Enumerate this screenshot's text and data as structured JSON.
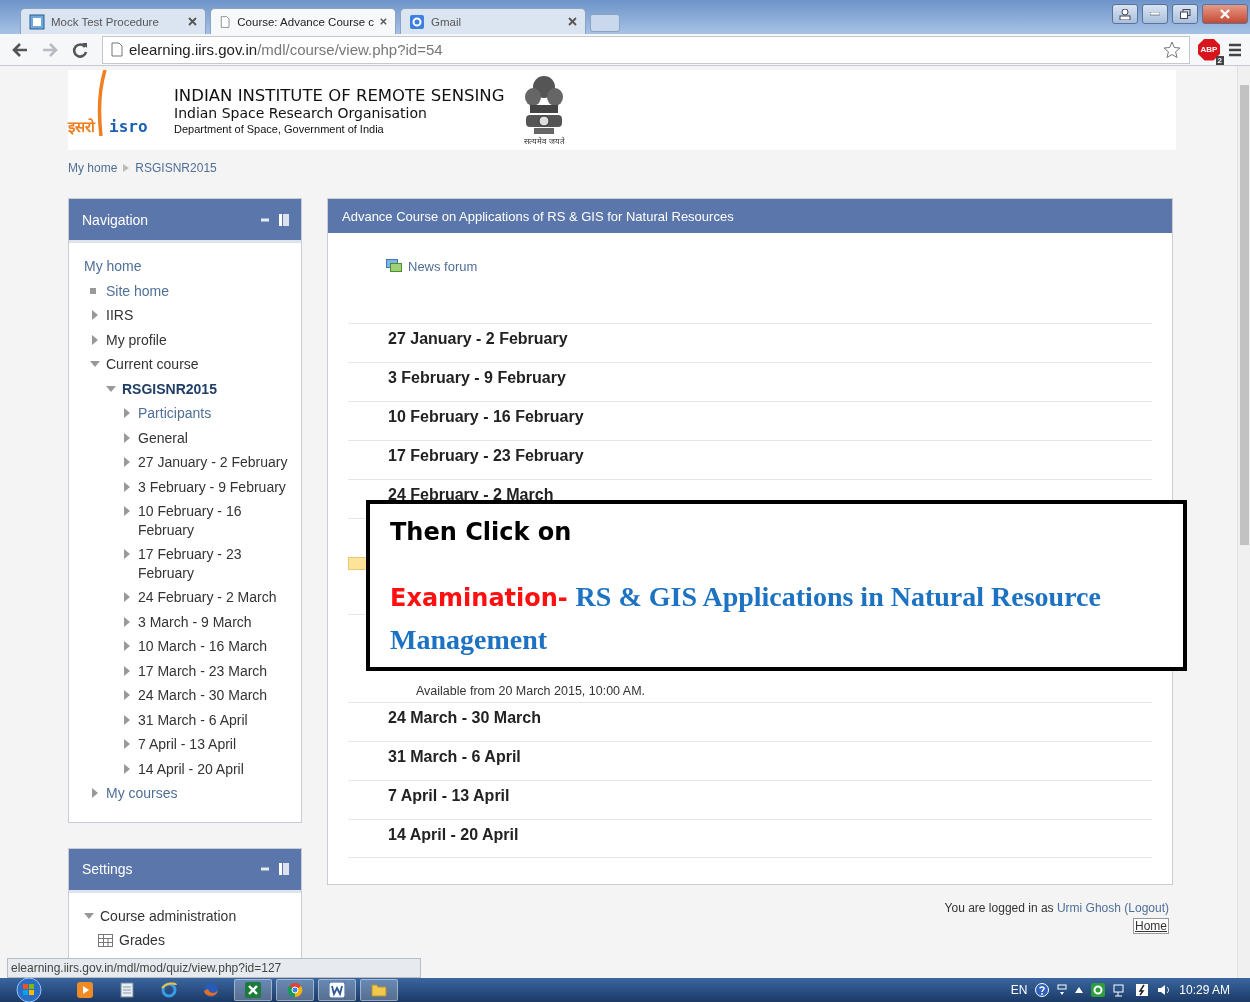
{
  "browser": {
    "tabs": [
      {
        "title": "Mock Test Procedure",
        "selected": false
      },
      {
        "title": "Course: Advance Course c",
        "selected": true
      },
      {
        "title": "Gmail",
        "selected": false
      }
    ],
    "nav_buttons": [
      {
        "kind": "back",
        "disabled": false
      },
      {
        "kind": "forward",
        "disabled": true
      },
      {
        "kind": "reload",
        "disabled": false
      }
    ],
    "address": {
      "host": "elearning.iirs.gov.in",
      "path": "/mdl/course/view.php?id=54"
    },
    "extension": {
      "label": "ABP",
      "badge": "2"
    }
  },
  "header": {
    "logo_text": [
      "इसरो",
      "isro"
    ],
    "title": "INDIAN INSTITUTE OF REMOTE SENSING",
    "subtitle": "Indian Space Research Organisation",
    "department": "Department of Space, Government of India",
    "motto": "सत्यमेव जयते"
  },
  "breadcrumb": [
    "My home",
    "RSGISNR2015"
  ],
  "navigation": {
    "title": "Navigation",
    "items": [
      {
        "label": "My home",
        "kind": "home",
        "link": true,
        "children": [
          {
            "label": "Site home",
            "kind": "leaf",
            "link": true
          },
          {
            "label": "IIRS",
            "kind": "branch",
            "expanded": false,
            "link": false
          },
          {
            "label": "My profile",
            "kind": "branch",
            "expanded": false,
            "link": false
          },
          {
            "label": "Current course",
            "kind": "branch",
            "expanded": true,
            "link": false,
            "children": [
              {
                "label": "RSGISNR2015",
                "kind": "branch",
                "expanded": true,
                "current": true,
                "children": [
                  {
                    "label": "Participants",
                    "kind": "branch",
                    "expanded": false,
                    "link": true
                  },
                  {
                    "label": "General",
                    "kind": "branch",
                    "expanded": false,
                    "link": false
                  },
                  {
                    "label": "27 January - 2 February",
                    "kind": "branch",
                    "expanded": false,
                    "link": false
                  },
                  {
                    "label": "3 February - 9 February",
                    "kind": "branch",
                    "expanded": false,
                    "link": false
                  },
                  {
                    "label": "10 February - 16 February",
                    "kind": "branch",
                    "expanded": false,
                    "link": false
                  },
                  {
                    "label": "17 February - 23 February",
                    "kind": "branch",
                    "expanded": false,
                    "link": false
                  },
                  {
                    "label": "24 February - 2 March",
                    "kind": "branch",
                    "expanded": false,
                    "link": false
                  },
                  {
                    "label": "3 March - 9 March",
                    "kind": "branch",
                    "expanded": false,
                    "link": false
                  },
                  {
                    "label": "10 March - 16 March",
                    "kind": "branch",
                    "expanded": false,
                    "link": false
                  },
                  {
                    "label": "17 March - 23 March",
                    "kind": "branch",
                    "expanded": false,
                    "link": false
                  },
                  {
                    "label": "24 March - 30 March",
                    "kind": "branch",
                    "expanded": false,
                    "link": false
                  },
                  {
                    "label": "31 March - 6 April",
                    "kind": "branch",
                    "expanded": false,
                    "link": false
                  },
                  {
                    "label": "7 April - 13 April",
                    "kind": "branch",
                    "expanded": false,
                    "link": false
                  },
                  {
                    "label": "14 April - 20 April",
                    "kind": "branch",
                    "expanded": false,
                    "link": false
                  }
                ]
              }
            ]
          },
          {
            "label": "My courses",
            "kind": "branch",
            "expanded": false,
            "link": true
          }
        ]
      }
    ]
  },
  "settings": {
    "title": "Settings",
    "items": [
      {
        "label": "Course administration",
        "kind": "branch",
        "expanded": true,
        "link": false,
        "children": [
          {
            "label": "Grades",
            "kind": "grades",
            "link": false
          }
        ]
      }
    ]
  },
  "course": {
    "title": "Advance Course on Applications of RS & GIS for Natural Resources",
    "news": "News forum",
    "sections": [
      {
        "kind": "section",
        "title": "27 January - 2 February"
      },
      {
        "kind": "section",
        "title": "3 February - 9 February"
      },
      {
        "kind": "section",
        "title": "10 February - 16 February"
      },
      {
        "kind": "section",
        "title": "17 February - 23 February"
      },
      {
        "kind": "section",
        "title": "24 February - 2 March"
      },
      {
        "kind": "obscured"
      },
      {
        "kind": "availability",
        "text": "Available from 20 March 2015, 10:00 AM."
      },
      {
        "kind": "section",
        "title": "24 March - 30 March"
      },
      {
        "kind": "section",
        "title": "31 March - 6 April"
      },
      {
        "kind": "section",
        "title": "7 April - 13 April"
      },
      {
        "kind": "section",
        "title": "14 April - 20 April"
      }
    ]
  },
  "instruction": {
    "lead": "Then Click on",
    "label": "Examination-",
    "title": "RS & GIS Applications in Natural Resource Management"
  },
  "footer": {
    "prefix": "You are logged in as",
    "user": "Urmi Ghosh",
    "logout": "(Logout)",
    "home": "Home"
  },
  "status_url": "elearning.iirs.gov.in/mdl/mod/quiz/view.php?id=127",
  "taskbar": {
    "language": "EN",
    "clock": "10:29 AM"
  }
}
